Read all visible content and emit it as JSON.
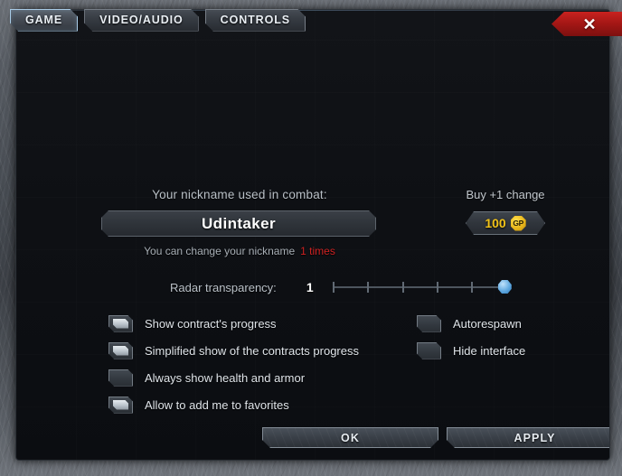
{
  "window": {
    "close_label": "✕"
  },
  "tabs": [
    {
      "label": "GAME",
      "active": true
    },
    {
      "label": "VIDEO/AUDIO",
      "active": false
    },
    {
      "label": "CONTROLS",
      "active": false
    }
  ],
  "nickname": {
    "label": "Your nickname used in combat:",
    "value": "Udintaker",
    "placeholder": "Udintaker",
    "help_text": "You can change your nickname",
    "help_count": "1 times",
    "help_count_color": "#cf2222"
  },
  "buy": {
    "label": "Buy +1 change",
    "amount": "100",
    "currency": "GP",
    "currency_color": "#e8b51a"
  },
  "slider": {
    "label": "Radar transparency:",
    "value": "1",
    "min": 0,
    "max": 5,
    "current": 5,
    "ticks": 6
  },
  "options_left": [
    {
      "label": "Show contract's progress",
      "checked": true
    },
    {
      "label": "Simplified show of the contracts progress",
      "checked": true
    },
    {
      "label": "Always show health and armor",
      "checked": false
    },
    {
      "label": "Allow to add me to favorites",
      "checked": true
    }
  ],
  "options_right": [
    {
      "label": "Autorespawn",
      "checked": false
    },
    {
      "label": "Hide interface",
      "checked": false
    }
  ],
  "footer": {
    "ok_label": "OK",
    "apply_label": "APPLY"
  }
}
